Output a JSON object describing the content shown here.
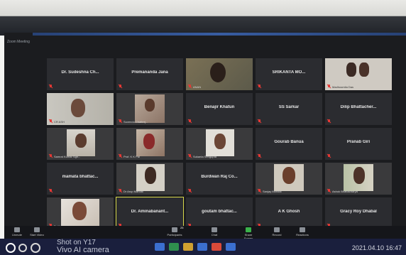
{
  "top_caption": "",
  "window": {
    "title": "Zoom Meeting"
  },
  "tiles": [
    {
      "name": "Dr. Sudeshna Ch...",
      "label": "",
      "video": false
    },
    {
      "name": "Premananda Jana",
      "label": "",
      "video": false
    },
    {
      "name": "",
      "label": "ANAN",
      "video": true
    },
    {
      "name": "SRIKANTA MO...",
      "label": "",
      "video": false
    },
    {
      "name": "",
      "label": "Madhusmita Das",
      "video": true
    },
    {
      "name": "",
      "label": "CR ASH",
      "video": true
    },
    {
      "name": "",
      "label": "Suvendu Chatterj...",
      "video": true
    },
    {
      "name": "Benajir Khatun",
      "label": "",
      "video": false
    },
    {
      "name": "SS Sarkar",
      "label": "",
      "video": false
    },
    {
      "name": "Dilip Bhattacher...",
      "label": "",
      "video": false
    },
    {
      "name": "",
      "label": "Samrat Kumar Sgh...",
      "video": true
    },
    {
      "name": "",
      "label": "Prof. K K Pal",
      "video": true
    },
    {
      "name": "",
      "label": "Sukanta Sengupta",
      "video": true
    },
    {
      "name": "Gourab Banua",
      "label": "",
      "video": false
    },
    {
      "name": "Pranab Giri",
      "label": "",
      "video": false
    },
    {
      "name": "mamata bhattac...",
      "label": "",
      "video": false
    },
    {
      "name": "",
      "label": "Dr Arup Mandal",
      "video": true
    },
    {
      "name": "Burdwan Raj Co...",
      "label": "",
      "video": false
    },
    {
      "name": "",
      "label": "Sanjay Mondal",
      "video": true
    },
    {
      "name": "",
      "label": "Ashok Bhattacharya",
      "video": true
    },
    {
      "name": "",
      "label": "Dr Manas Pandey",
      "video": true
    },
    {
      "name": "Dr. Aminabanant...",
      "label": "",
      "video": false
    },
    {
      "name": "goutam bhattac...",
      "label": "",
      "video": false
    },
    {
      "name": "A K Ghosh",
      "label": "",
      "video": false
    },
    {
      "name": "Gracy Roy Dhabal",
      "label": "",
      "video": false
    }
  ],
  "toolbar": {
    "unmute": "Unmute",
    "start_video": "Start Video",
    "participants": "Participants",
    "participants_count": "25",
    "chat": "Chat",
    "share_screen": "Share Screen",
    "record": "Record",
    "reactions": "Reactions"
  },
  "taskbar": {
    "shot_text": "Shot on Y17",
    "camera_text": "Vivo AI camera",
    "clock": "2021.04.10 16:47"
  },
  "colors": {
    "window_bg": "#1b1c1f",
    "tile_bg": "#2b2c30",
    "mute_red": "#e53935",
    "active_border": "#d8d84a",
    "taskbar_bg": "#1a1f3d"
  }
}
